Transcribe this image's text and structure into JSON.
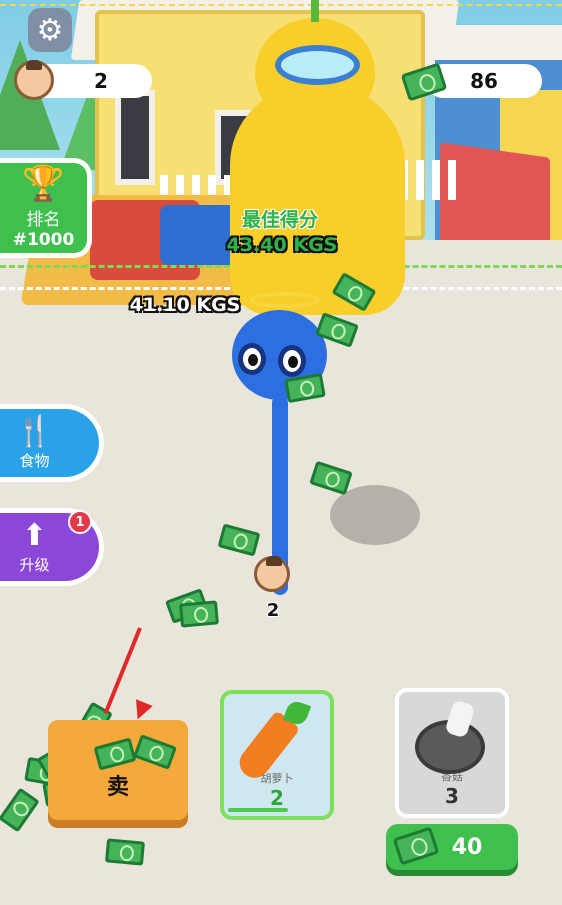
{
  "hud": {
    "muscle_count": "2",
    "money": "86"
  },
  "rank": {
    "label": "排名",
    "value": "#1000"
  },
  "best_score": {
    "label": "最佳得分",
    "value": "43.40 KGS"
  },
  "player": {
    "weight": "41.10 KGS",
    "count": "2"
  },
  "side_buttons": {
    "food_label": "食物",
    "upgrade_label": "升级",
    "upgrade_badge": "1"
  },
  "sell": {
    "label": "卖"
  },
  "food_cards": [
    {
      "name": "胡萝卜",
      "count": "2",
      "selected": true
    },
    {
      "name": "香菇",
      "count": "3",
      "selected": false
    }
  ],
  "buy": {
    "price": "40"
  },
  "icons": {
    "settings": "gear-icon",
    "money": "money-icon",
    "trophy": "trophy-icon",
    "food": "fork-knife-icon",
    "upgrade": "up-arrow-icon"
  },
  "colors": {
    "accent_green": "#3fbf4d",
    "food_blue": "#2aa2ea",
    "upgrade_purple": "#8a47d8",
    "sell_orange": "#f5a93a",
    "arrow_red": "#e02828"
  }
}
